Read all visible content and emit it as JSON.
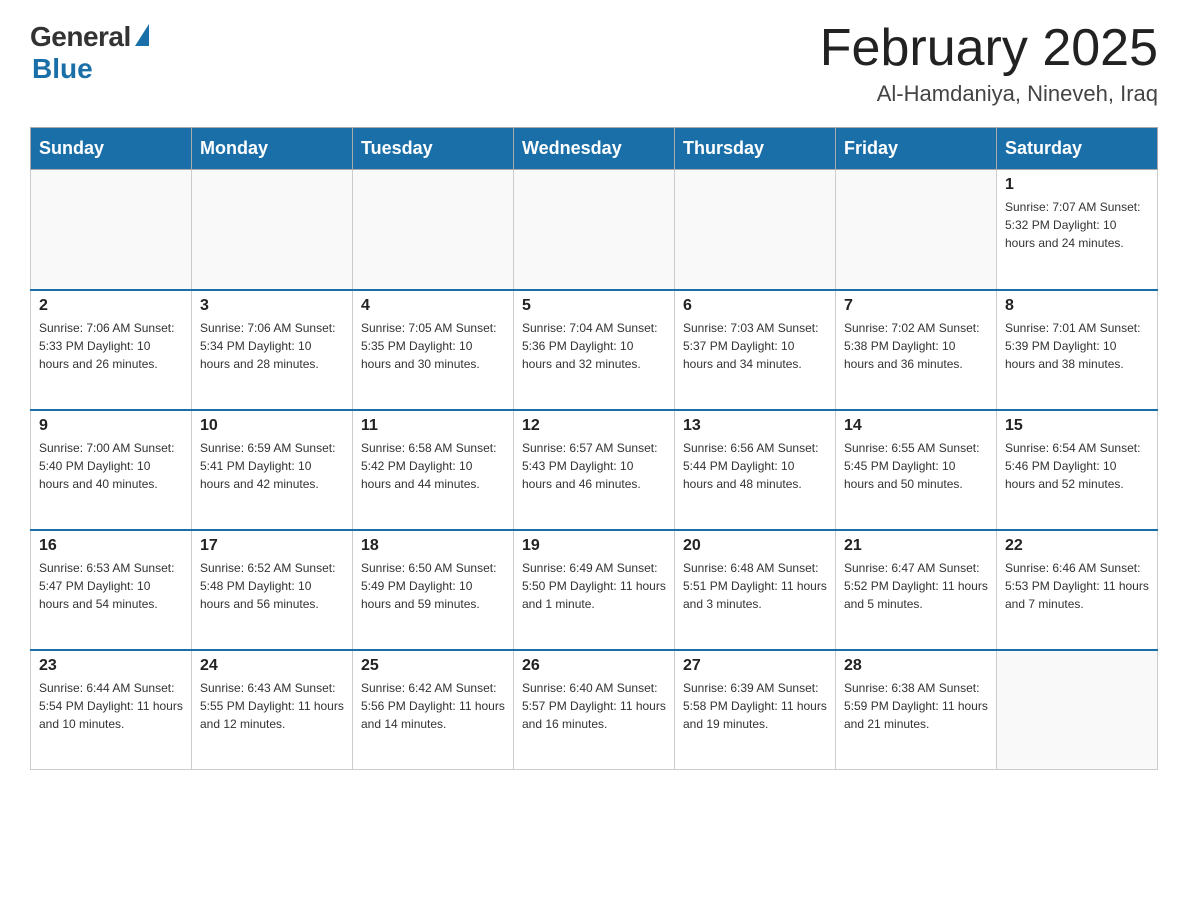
{
  "header": {
    "logo_general": "General",
    "logo_blue": "Blue",
    "title": "February 2025",
    "subtitle": "Al-Hamdaniya, Nineveh, Iraq"
  },
  "days_of_week": [
    "Sunday",
    "Monday",
    "Tuesday",
    "Wednesday",
    "Thursday",
    "Friday",
    "Saturday"
  ],
  "weeks": [
    {
      "days": [
        {
          "number": "",
          "info": ""
        },
        {
          "number": "",
          "info": ""
        },
        {
          "number": "",
          "info": ""
        },
        {
          "number": "",
          "info": ""
        },
        {
          "number": "",
          "info": ""
        },
        {
          "number": "",
          "info": ""
        },
        {
          "number": "1",
          "info": "Sunrise: 7:07 AM\nSunset: 5:32 PM\nDaylight: 10 hours and 24 minutes."
        }
      ]
    },
    {
      "days": [
        {
          "number": "2",
          "info": "Sunrise: 7:06 AM\nSunset: 5:33 PM\nDaylight: 10 hours and 26 minutes."
        },
        {
          "number": "3",
          "info": "Sunrise: 7:06 AM\nSunset: 5:34 PM\nDaylight: 10 hours and 28 minutes."
        },
        {
          "number": "4",
          "info": "Sunrise: 7:05 AM\nSunset: 5:35 PM\nDaylight: 10 hours and 30 minutes."
        },
        {
          "number": "5",
          "info": "Sunrise: 7:04 AM\nSunset: 5:36 PM\nDaylight: 10 hours and 32 minutes."
        },
        {
          "number": "6",
          "info": "Sunrise: 7:03 AM\nSunset: 5:37 PM\nDaylight: 10 hours and 34 minutes."
        },
        {
          "number": "7",
          "info": "Sunrise: 7:02 AM\nSunset: 5:38 PM\nDaylight: 10 hours and 36 minutes."
        },
        {
          "number": "8",
          "info": "Sunrise: 7:01 AM\nSunset: 5:39 PM\nDaylight: 10 hours and 38 minutes."
        }
      ]
    },
    {
      "days": [
        {
          "number": "9",
          "info": "Sunrise: 7:00 AM\nSunset: 5:40 PM\nDaylight: 10 hours and 40 minutes."
        },
        {
          "number": "10",
          "info": "Sunrise: 6:59 AM\nSunset: 5:41 PM\nDaylight: 10 hours and 42 minutes."
        },
        {
          "number": "11",
          "info": "Sunrise: 6:58 AM\nSunset: 5:42 PM\nDaylight: 10 hours and 44 minutes."
        },
        {
          "number": "12",
          "info": "Sunrise: 6:57 AM\nSunset: 5:43 PM\nDaylight: 10 hours and 46 minutes."
        },
        {
          "number": "13",
          "info": "Sunrise: 6:56 AM\nSunset: 5:44 PM\nDaylight: 10 hours and 48 minutes."
        },
        {
          "number": "14",
          "info": "Sunrise: 6:55 AM\nSunset: 5:45 PM\nDaylight: 10 hours and 50 minutes."
        },
        {
          "number": "15",
          "info": "Sunrise: 6:54 AM\nSunset: 5:46 PM\nDaylight: 10 hours and 52 minutes."
        }
      ]
    },
    {
      "days": [
        {
          "number": "16",
          "info": "Sunrise: 6:53 AM\nSunset: 5:47 PM\nDaylight: 10 hours and 54 minutes."
        },
        {
          "number": "17",
          "info": "Sunrise: 6:52 AM\nSunset: 5:48 PM\nDaylight: 10 hours and 56 minutes."
        },
        {
          "number": "18",
          "info": "Sunrise: 6:50 AM\nSunset: 5:49 PM\nDaylight: 10 hours and 59 minutes."
        },
        {
          "number": "19",
          "info": "Sunrise: 6:49 AM\nSunset: 5:50 PM\nDaylight: 11 hours and 1 minute."
        },
        {
          "number": "20",
          "info": "Sunrise: 6:48 AM\nSunset: 5:51 PM\nDaylight: 11 hours and 3 minutes."
        },
        {
          "number": "21",
          "info": "Sunrise: 6:47 AM\nSunset: 5:52 PM\nDaylight: 11 hours and 5 minutes."
        },
        {
          "number": "22",
          "info": "Sunrise: 6:46 AM\nSunset: 5:53 PM\nDaylight: 11 hours and 7 minutes."
        }
      ]
    },
    {
      "days": [
        {
          "number": "23",
          "info": "Sunrise: 6:44 AM\nSunset: 5:54 PM\nDaylight: 11 hours and 10 minutes."
        },
        {
          "number": "24",
          "info": "Sunrise: 6:43 AM\nSunset: 5:55 PM\nDaylight: 11 hours and 12 minutes."
        },
        {
          "number": "25",
          "info": "Sunrise: 6:42 AM\nSunset: 5:56 PM\nDaylight: 11 hours and 14 minutes."
        },
        {
          "number": "26",
          "info": "Sunrise: 6:40 AM\nSunset: 5:57 PM\nDaylight: 11 hours and 16 minutes."
        },
        {
          "number": "27",
          "info": "Sunrise: 6:39 AM\nSunset: 5:58 PM\nDaylight: 11 hours and 19 minutes."
        },
        {
          "number": "28",
          "info": "Sunrise: 6:38 AM\nSunset: 5:59 PM\nDaylight: 11 hours and 21 minutes."
        },
        {
          "number": "",
          "info": ""
        }
      ]
    }
  ]
}
